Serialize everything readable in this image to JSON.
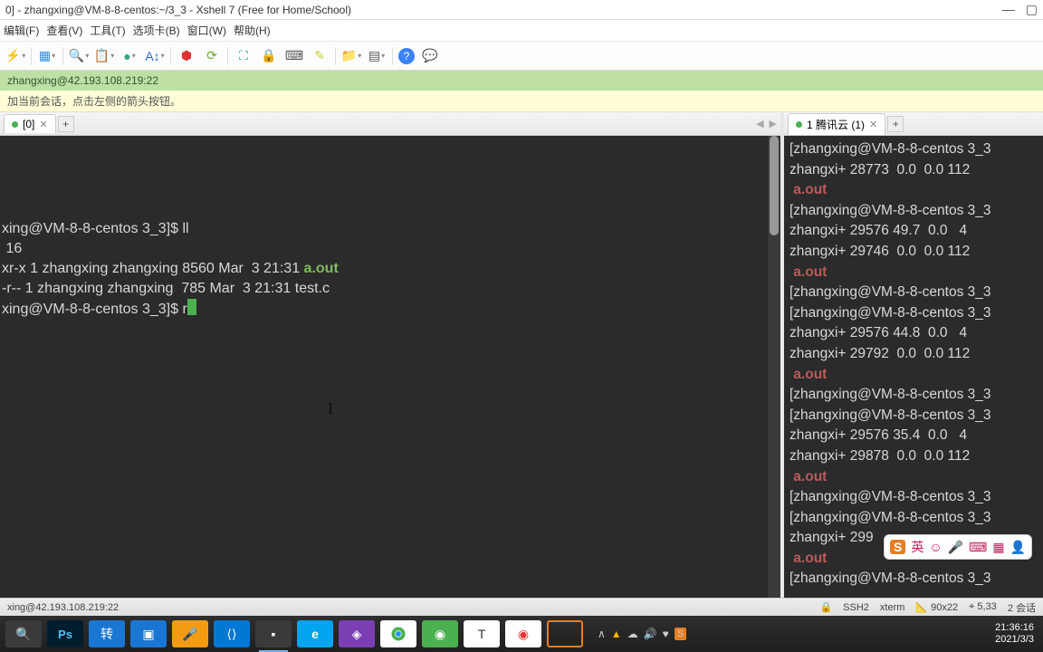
{
  "title": "0] - zhangxing@VM-8-8-centos:~/3_3 - Xshell 7 (Free for Home/School)",
  "menu": [
    "编辑(F)",
    "查看(V)",
    "工具(T)",
    "选项卡(B)",
    "窗口(W)",
    "帮助(H)"
  ],
  "connbar": "zhangxing@42.193.108.219:22",
  "infobar": "加当前会话，点击左侧的箭头按钮。",
  "tab_left": "[0]",
  "tab_right": "1 腾讯云 (1)",
  "left_lines": [
    {
      "t": "xing@VM-8-8-centos 3_3]$ ll"
    },
    {
      "t": " 16"
    },
    {
      "t": "xr-x 1 zhangxing zhangxing 8560 Mar  3 21:31 ",
      "g": "a.out"
    },
    {
      "t": "-r-- 1 zhangxing zhangxing  785 Mar  3 21:31 test.c"
    },
    {
      "t": "xing@VM-8-8-centos 3_3]$ r",
      "cursor": true
    }
  ],
  "right_lines": [
    {
      "t": "[zhangxing@VM-8-8-centos 3_3"
    },
    {
      "t": "zhangxi+ 28773  0.0  0.0 112"
    },
    {
      "r": " a.out"
    },
    {
      "t": "[zhangxing@VM-8-8-centos 3_3"
    },
    {
      "t": "zhangxi+ 29576 49.7  0.0   4"
    },
    {
      "t": "zhangxi+ 29746  0.0  0.0 112"
    },
    {
      "r": " a.out"
    },
    {
      "t": "[zhangxing@VM-8-8-centos 3_3"
    },
    {
      "t": "[zhangxing@VM-8-8-centos 3_3"
    },
    {
      "t": "zhangxi+ 29576 44.8  0.0   4"
    },
    {
      "t": "zhangxi+ 29792  0.0  0.0 112"
    },
    {
      "r": " a.out"
    },
    {
      "t": "[zhangxing@VM-8-8-centos 3_3"
    },
    {
      "t": "[zhangxing@VM-8-8-centos 3_3"
    },
    {
      "t": "zhangxi+ 29576 35.4  0.0   4"
    },
    {
      "t": "zhangxi+ 29878  0.0  0.0 112"
    },
    {
      "r": " a.out"
    },
    {
      "t": "[zhangxing@VM-8-8-centos 3_3"
    },
    {
      "t": "[zhangxing@VM-8-8-centos 3_3"
    },
    {
      "t": "zhangxi+ 299"
    },
    {
      "r": " a.out"
    },
    {
      "t": "[zhangxing@VM-8-8-centos 3_3"
    }
  ],
  "status": {
    "conn": "xing@42.193.108.219:22",
    "ssh": "SSH2",
    "term": "xterm",
    "size": "90x22",
    "pos": "5,33",
    "sess": "2 会话"
  },
  "clock": {
    "time": "21:36:16",
    "date": "2021/3/3"
  },
  "ime": "英"
}
